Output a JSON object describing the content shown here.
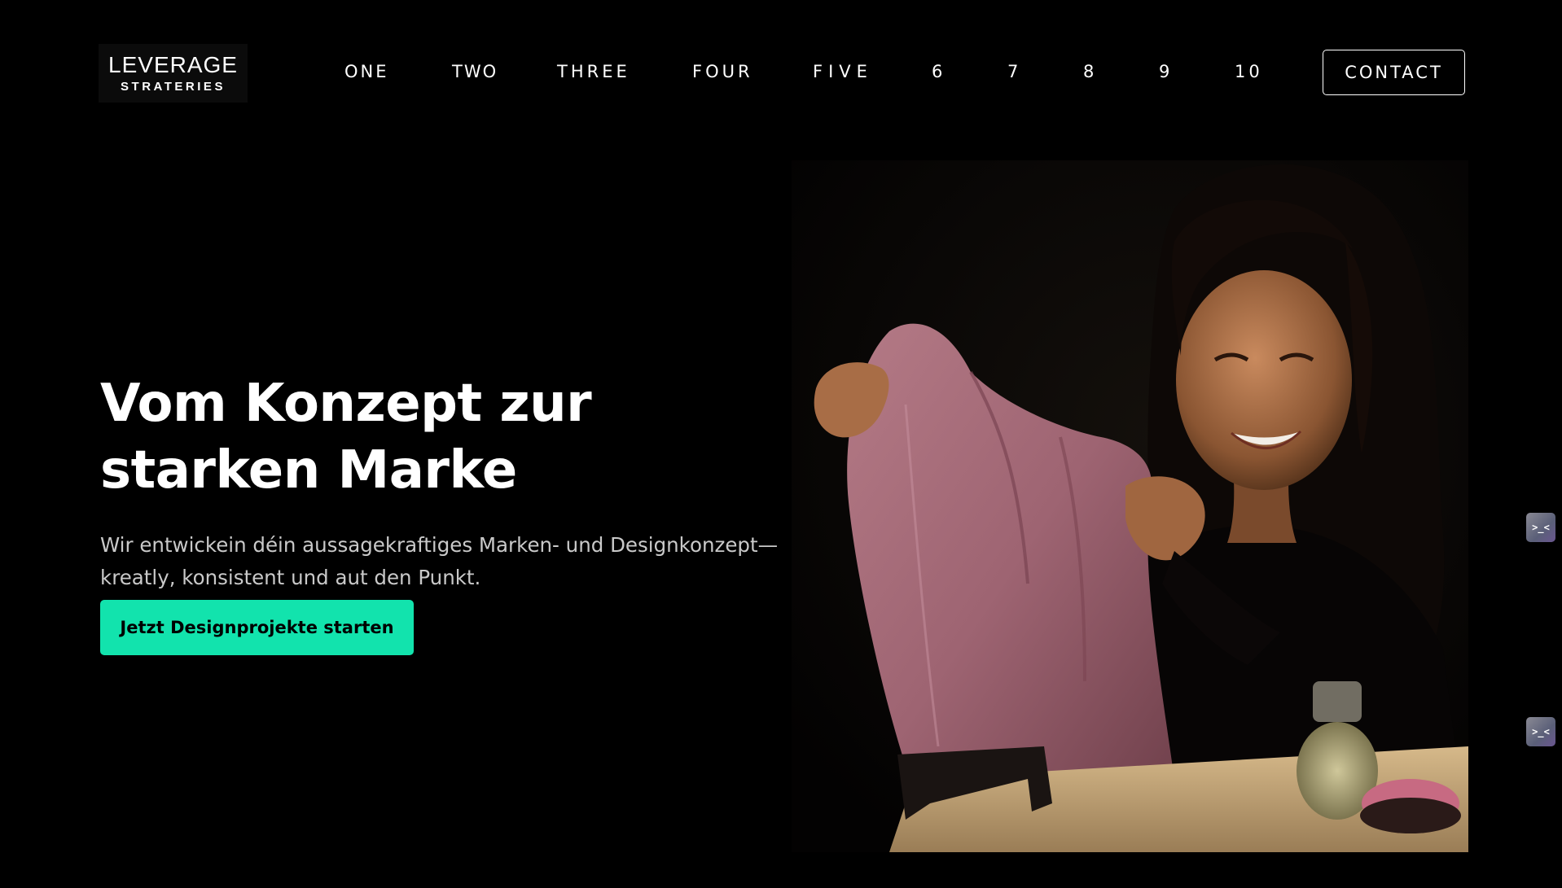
{
  "brand": {
    "name": "LEVERAGE",
    "tagline": "STRATERIES"
  },
  "nav": {
    "items": [
      {
        "label": "ONE"
      },
      {
        "label": "TWO"
      },
      {
        "label": "THREE"
      },
      {
        "label": "FOUR"
      },
      {
        "label": "FIVE"
      },
      {
        "label": "6"
      },
      {
        "label": "7"
      },
      {
        "label": "8"
      },
      {
        "label": "9"
      },
      {
        "label": "10"
      }
    ],
    "contact_label": "CONTACT"
  },
  "hero": {
    "title": "Vom Konzept zur starken Marke",
    "subtitle": "Wir entwickein déin aussagekraftiges Marken- und Designkonzept—kreatly, konsistent und aut den Punkt.",
    "cta_label": "Jetzt Designprojekte starten",
    "image_icon": "photo-woman-holding-pink-garment-icon"
  },
  "side_widgets": [
    {
      "glyph": ">_<",
      "icon": "chat-widget-icon"
    },
    {
      "glyph": ">_<",
      "icon": "chat-widget-icon"
    }
  ],
  "colors": {
    "background": "#000000",
    "text": "#ffffff",
    "subtitle": "#c9c9c9",
    "accent": "#12e3ad"
  }
}
